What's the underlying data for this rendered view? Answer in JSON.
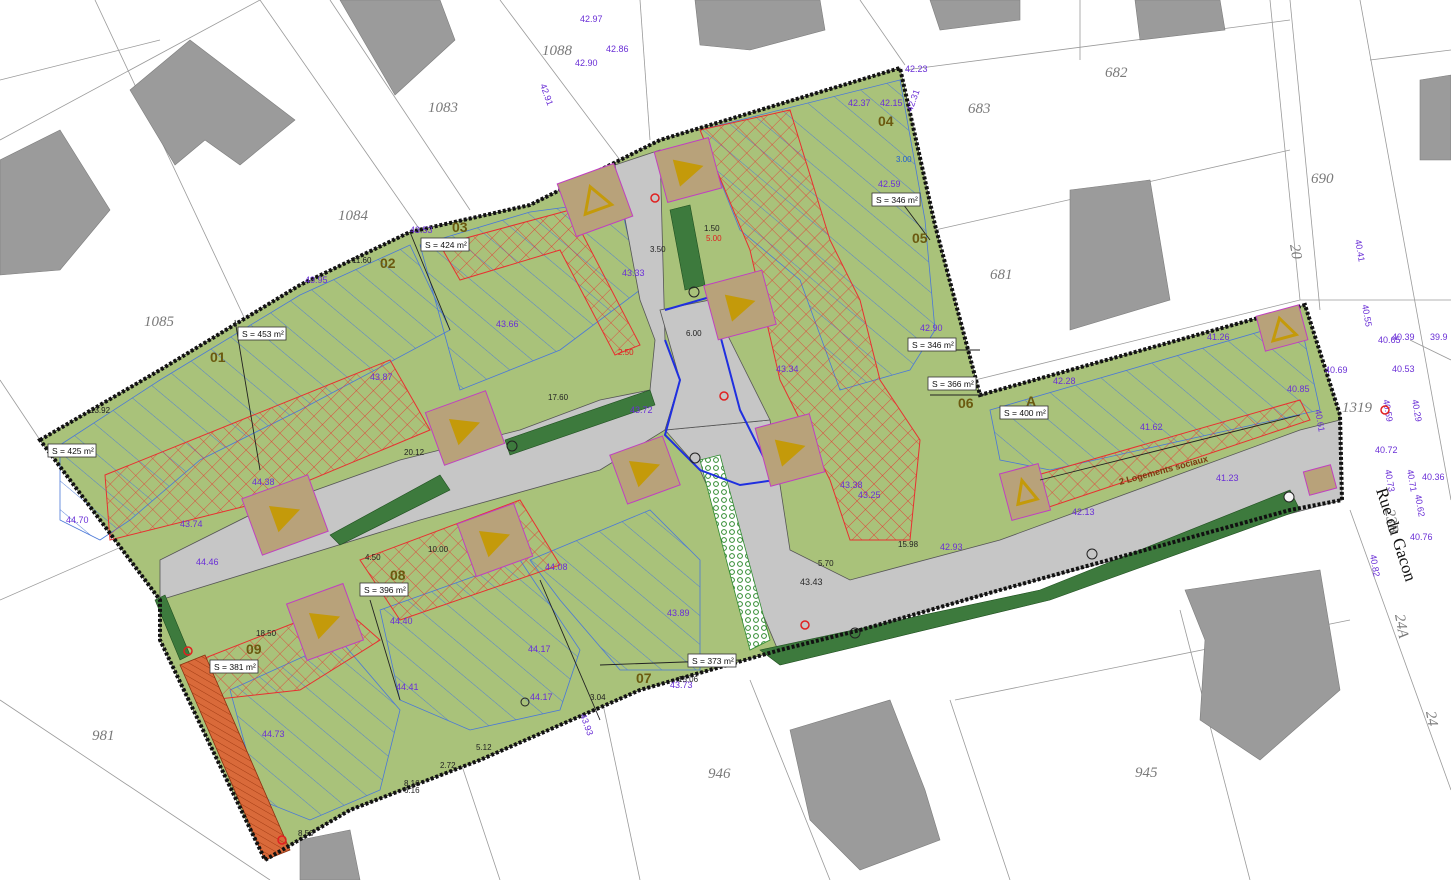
{
  "parcels": [
    "1083",
    "1088",
    "682",
    "683",
    "1084",
    "690",
    "681",
    "1085",
    "1319",
    "981",
    "946",
    "945",
    "20",
    "23B",
    "24A",
    "24"
  ],
  "lots": [
    {
      "num": "01",
      "area": "S = 453 m²"
    },
    {
      "num": "02",
      "area": "S = 424 m²"
    },
    {
      "num": "03",
      "area": "S = 424 m²"
    },
    {
      "num": "04",
      "area": "S = 346 m²"
    },
    {
      "num": "05",
      "area": "S = 346 m²"
    },
    {
      "num": "06",
      "area": "S = 366 m²"
    },
    {
      "num": "07",
      "area": "S = 373 m²"
    },
    {
      "num": "08",
      "area": "S = 396 m²"
    },
    {
      "num": "09",
      "area": "S = 381 m²"
    },
    {
      "num": "A",
      "area": "S = 400 m²"
    }
  ],
  "extra_area": "S = 425 m²",
  "social_housing_label": "2 Logements sociaux",
  "street_name": "Rue du Gacon",
  "elevations": [
    "42.97",
    "42.90",
    "42.86",
    "42.91",
    "42.23",
    "42.37",
    "42.15",
    "42.31",
    "42.59",
    "43.33",
    "43.66",
    "43.87",
    "43.72",
    "43.34",
    "42.90",
    "42.28",
    "41.26",
    "41.62",
    "41.23",
    "42.13",
    "42.93",
    "43.43",
    "43.25",
    "43.38",
    "44.08",
    "43.89",
    "44.17",
    "44.40",
    "44.41",
    "44.73",
    "44.70",
    "43.74",
    "44.46",
    "44.38",
    "44.17",
    "43.95",
    "43.93",
    "43.53",
    "43.73",
    "40.85",
    "40.69",
    "40.61",
    "40.65",
    "40.39",
    "40.53",
    "40.41",
    "40.29",
    "40.59",
    "40.72",
    "40.73",
    "40.71",
    "40.62",
    "40.36",
    "40.76",
    "40.82",
    "40.55",
    "39.9"
  ],
  "dimensions": [
    "5.00",
    "3.50",
    "1.50",
    "6.00",
    "2.50",
    "3.00",
    "17.60",
    "20.12",
    "18.50",
    "10.00",
    "15.06",
    "15.98",
    "13.92",
    "11.60",
    "5.70",
    "4.50",
    "8.16",
    "8.50",
    "3.04",
    "5.12",
    "2.72",
    "6.16"
  ]
}
